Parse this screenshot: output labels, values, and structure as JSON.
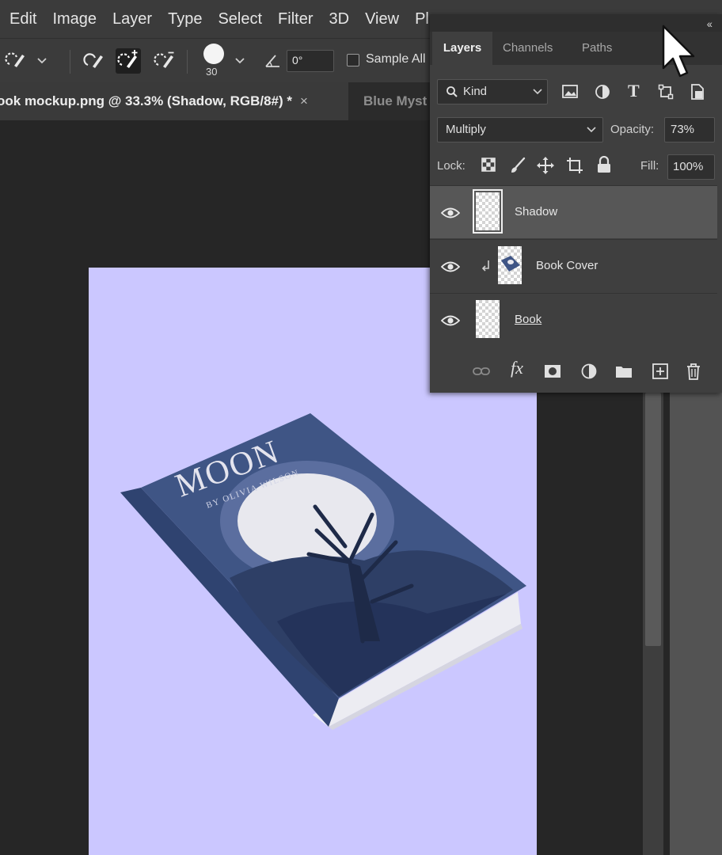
{
  "menubar": {
    "items": [
      "Edit",
      "Image",
      "Layer",
      "Type",
      "Select",
      "Filter",
      "3D",
      "View",
      "Plug"
    ]
  },
  "options": {
    "brush_size": "30",
    "angle_value": "0°",
    "sample_all_label": "Sample All"
  },
  "tabs": {
    "active": "ook mockup.png @ 33.3% (Shadow, RGB/8#) *",
    "close": "×",
    "second": "Blue Myst"
  },
  "document": {
    "background_color": "#cbc7ff",
    "book_title": "MOON",
    "book_author": "BY OLIVIA WILSON"
  },
  "layers_panel": {
    "collapse": "‹‹",
    "tabs": [
      "Layers",
      "Channels",
      "Paths"
    ],
    "filter_kind": "Kind",
    "blend_mode": "Multiply",
    "opacity_label": "Opacity:",
    "opacity_value": "73%",
    "lock_label": "Lock:",
    "fill_label": "Fill:",
    "fill_value": "100%",
    "layers": [
      {
        "name": "Shadow",
        "selected": true
      },
      {
        "name": "Book Cover",
        "selected": false
      },
      {
        "name": "Book",
        "selected": false
      }
    ]
  },
  "colors": {
    "accent_canvas": "#cbc7ff",
    "book_cover": "#3f5585",
    "panel_bg": "#3f3f3f"
  }
}
